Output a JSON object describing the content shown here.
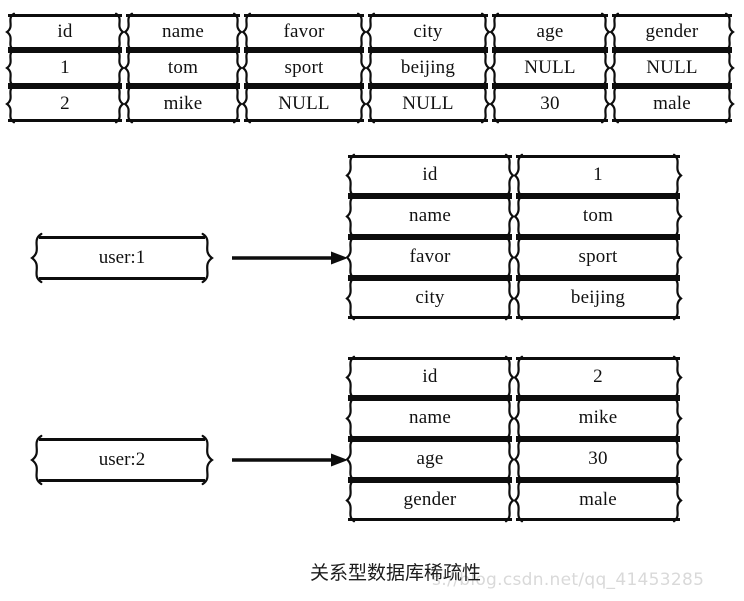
{
  "relational_table": {
    "name": "relational-table",
    "columns": [
      "id",
      "name",
      "favor",
      "city",
      "age",
      "gender"
    ],
    "rows": [
      [
        "1",
        "tom",
        "sport",
        "beijing",
        "NULL",
        "NULL"
      ],
      [
        "2",
        "mike",
        "NULL",
        "NULL",
        "30",
        "male"
      ]
    ]
  },
  "key_value_groups": [
    {
      "key_label": "user:1",
      "pairs": [
        {
          "field": "id",
          "value": "1"
        },
        {
          "field": "name",
          "value": "tom"
        },
        {
          "field": "favor",
          "value": "sport"
        },
        {
          "field": "city",
          "value": "beijing"
        }
      ]
    },
    {
      "key_label": "user:2",
      "pairs": [
        {
          "field": "id",
          "value": "2"
        },
        {
          "field": "name",
          "value": "mike"
        },
        {
          "field": "age",
          "value": "30"
        },
        {
          "field": "gender",
          "value": "male"
        }
      ]
    }
  ],
  "caption": "关系型数据库稀疏性",
  "watermark": "s://blog.csdn.net/qq_41453285",
  "colors": {
    "ink": "#0d0d0d",
    "text": "#111111",
    "background": "#ffffff",
    "watermark": "#d9d9d9"
  }
}
